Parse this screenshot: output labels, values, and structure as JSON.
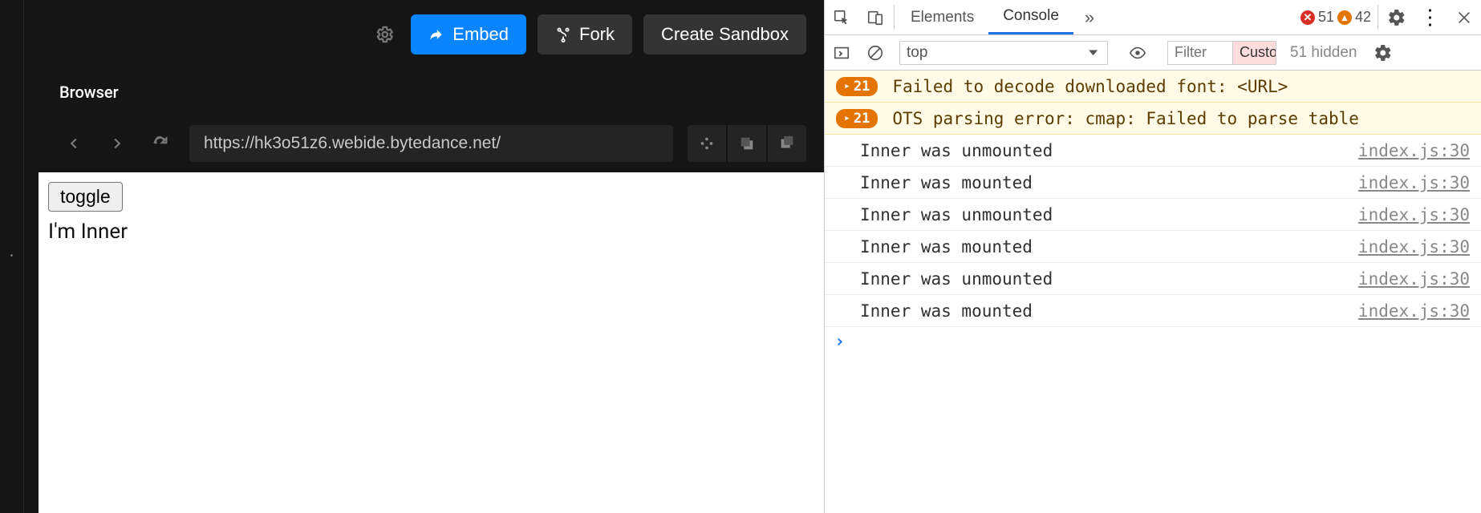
{
  "codesandbox": {
    "toolbar": {
      "embed_label": "Embed",
      "fork_label": "Fork",
      "create_label": "Create Sandbox"
    },
    "panel_title": "Browser",
    "url": "https://hk3o51z6.webide.bytedance.net/",
    "preview": {
      "toggle_label": "toggle",
      "inner_text": "I'm Inner"
    }
  },
  "devtools": {
    "tabs": {
      "elements": "Elements",
      "console": "Console"
    },
    "badges": {
      "errors": "51",
      "warnings": "42"
    },
    "filterbar": {
      "context": "top",
      "filter_placeholder": "Filter",
      "level_chip": "Custom levels",
      "hidden": "51 hidden"
    },
    "console_rows": [
      {
        "type": "warn",
        "count": "21",
        "msg": "Failed to decode downloaded font: <URL>"
      },
      {
        "type": "warn",
        "count": "21",
        "msg": "OTS parsing error: cmap: Failed to parse table"
      },
      {
        "type": "log",
        "msg": "Inner was unmounted",
        "src": "index.js:30"
      },
      {
        "type": "log",
        "msg": "Inner was mounted",
        "src": "index.js:30"
      },
      {
        "type": "log",
        "msg": "Inner was unmounted",
        "src": "index.js:30"
      },
      {
        "type": "log",
        "msg": "Inner was mounted",
        "src": "index.js:30"
      },
      {
        "type": "log",
        "msg": "Inner was unmounted",
        "src": "index.js:30"
      },
      {
        "type": "log",
        "msg": "Inner was mounted",
        "src": "index.js:30"
      }
    ]
  }
}
